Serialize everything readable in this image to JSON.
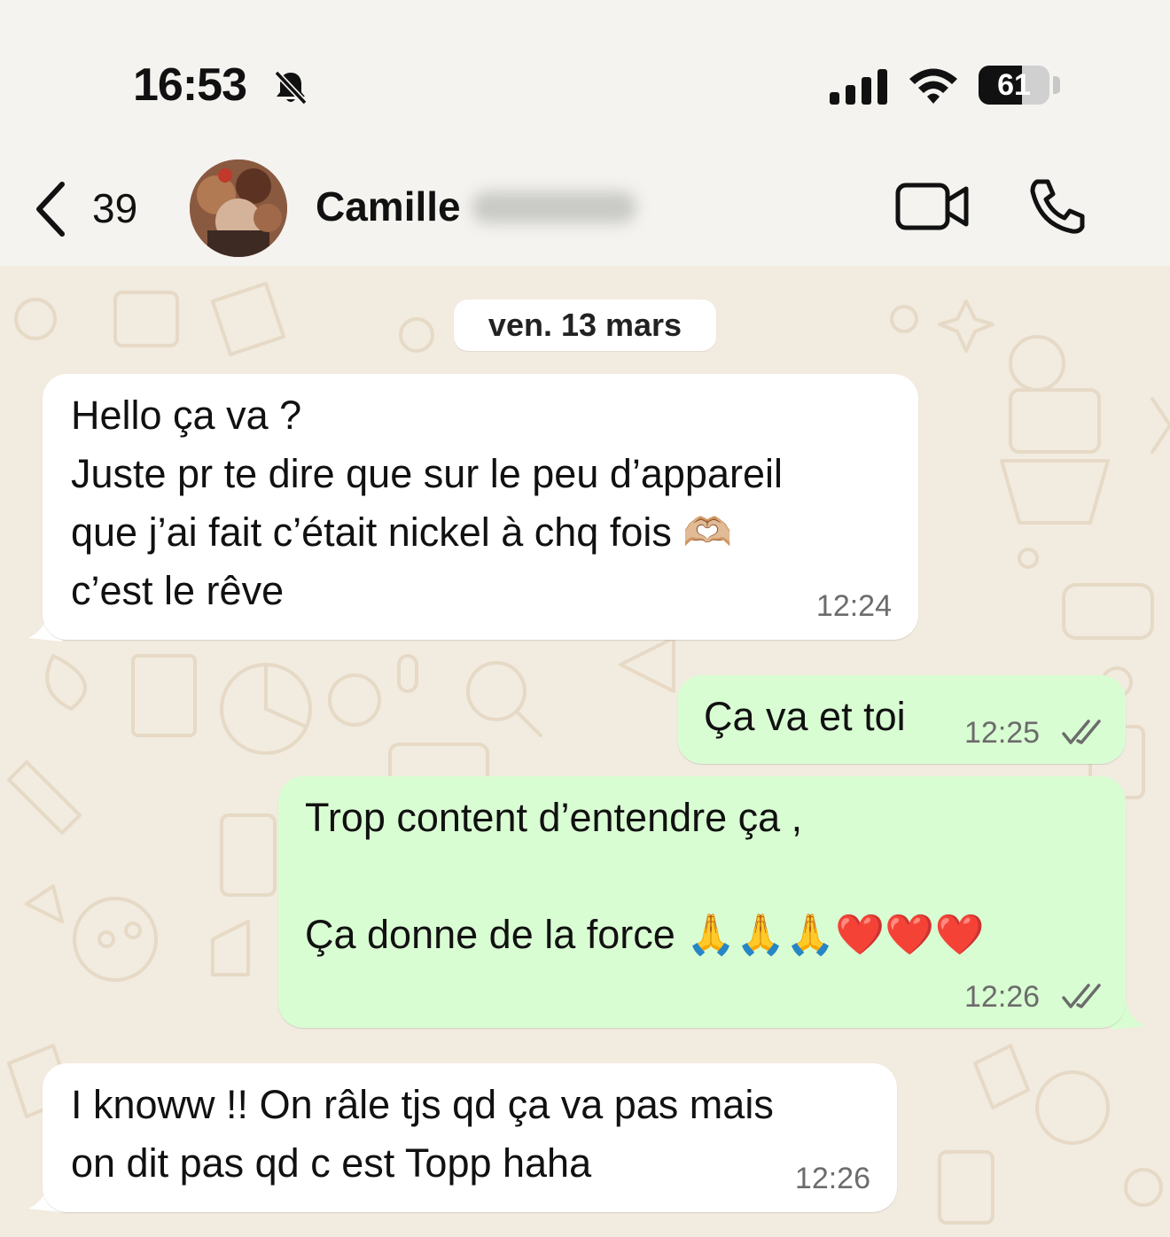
{
  "status_bar": {
    "time": "16:53",
    "battery": "61",
    "battery_level": 0.61
  },
  "header": {
    "back_count": "39",
    "contact_name": "Camille"
  },
  "chat": {
    "date_chip": "ven. 13 mars",
    "messages": [
      {
        "direction": "incoming",
        "text": "Hello ça va ?\nJuste pr te dire que sur le peu d’appareil\nque j’ai fait c’était nickel à chq fois 🫶🏼\nc’est le rêve",
        "time": "12:24"
      },
      {
        "direction": "outgoing",
        "text": "Ça va et toi",
        "time": "12:25",
        "read": true
      },
      {
        "direction": "outgoing",
        "text": "Trop content d’entendre ça ,\n\nÇa donne de la force 🙏🙏🙏❤️❤️❤️",
        "time": "12:26",
        "read": true
      },
      {
        "direction": "incoming",
        "text": "I knoww !! On râle tjs qd ça va pas mais\non dit pas qd c est Topp haha",
        "time": "12:26"
      }
    ]
  },
  "colors": {
    "outgoing_bubble": "#d9fdd3",
    "incoming_bubble": "#ffffff",
    "chat_background": "#f2ebdf",
    "tick_color": "#6c6c6c"
  },
  "icons": [
    "bell-slash-icon",
    "signal-icon",
    "wifi-icon",
    "battery-icon",
    "chevron-left-icon",
    "video-call-icon",
    "phone-call-icon",
    "double-check-icon"
  ]
}
